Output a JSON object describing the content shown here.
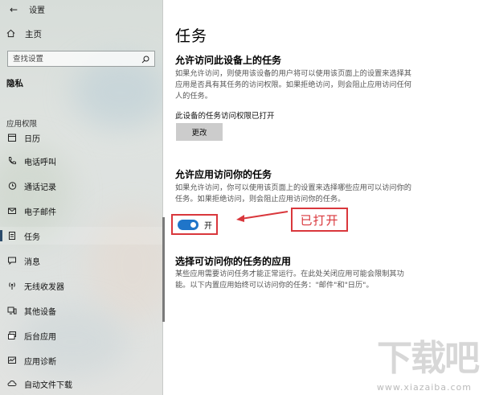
{
  "window": {
    "title": "设置",
    "back_icon": "back-arrow-icon"
  },
  "sidebar": {
    "home_label": "主页",
    "search_placeholder": "查找设置",
    "section_title": "隐私",
    "group_title": "应用权限",
    "items": [
      {
        "label": "日历",
        "icon": "calendar-icon"
      },
      {
        "label": "电话呼叫",
        "icon": "phone-icon"
      },
      {
        "label": "通话记录",
        "icon": "history-icon"
      },
      {
        "label": "电子邮件",
        "icon": "mail-icon"
      },
      {
        "label": "任务",
        "icon": "tasks-icon",
        "active": true
      },
      {
        "label": "消息",
        "icon": "message-icon"
      },
      {
        "label": "无线收发器",
        "icon": "radio-icon"
      },
      {
        "label": "其他设备",
        "icon": "devices-icon"
      },
      {
        "label": "后台应用",
        "icon": "background-apps-icon"
      },
      {
        "label": "应用诊断",
        "icon": "diagnostics-icon"
      },
      {
        "label": "自动文件下载",
        "icon": "cloud-download-icon"
      }
    ]
  },
  "main": {
    "title": "任务",
    "section1": {
      "heading": "允许访问此设备上的任务",
      "description": "如果允许访问，则使用该设备的用户将可以使用该页面上的设置来选择其应用是否具有其任务的访问权限。如果拒绝访问，则会阻止应用访问任何人的任务。",
      "status": "此设备的任务访问权限已打开",
      "button_label": "更改"
    },
    "section2": {
      "heading": "允许应用访问你的任务",
      "description": "如果允许访问，你可以使用该页面上的设置来选择哪些应用可以访问你的任务。如果拒绝访问，则会阻止应用访问你的任务。",
      "toggle_state": "开",
      "toggle_on": true
    },
    "section3": {
      "heading": "选择可访问你的任务的应用",
      "description": "某些应用需要访问任务才能正常运行。在此处关闭应用可能会限制其功能。以下内置应用始终可以访问你的任务：\"邮件\"和\"日历\"。"
    },
    "annotation": "已打开"
  },
  "watermark": {
    "main": "下载吧",
    "sub": "www.xiazaiba.com"
  },
  "colors": {
    "accent": "#1f75c9",
    "annotation": "#d9373c"
  }
}
